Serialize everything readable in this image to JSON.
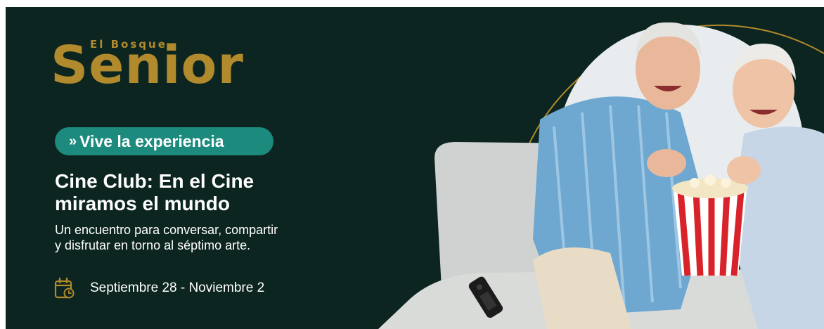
{
  "brand": {
    "small": "El Bosque",
    "big": "Senior"
  },
  "tagline": {
    "chevrons": "»",
    "label": "Vive la experiencia"
  },
  "title": {
    "line1": "Cine Club: En el Cine",
    "line2": "miramos el mundo"
  },
  "description": {
    "line1": "Un encuentro para conversar, compartir",
    "line2": "y disfrutar en torno al séptimo arte."
  },
  "dates": {
    "text": "Septiembre 28 -  Noviembre 2",
    "icon": "calendar-icon"
  },
  "colors": {
    "background": "#0c2520",
    "gold": "#b08a2c",
    "teal": "#1d8a7e",
    "text": "#ffffff"
  }
}
